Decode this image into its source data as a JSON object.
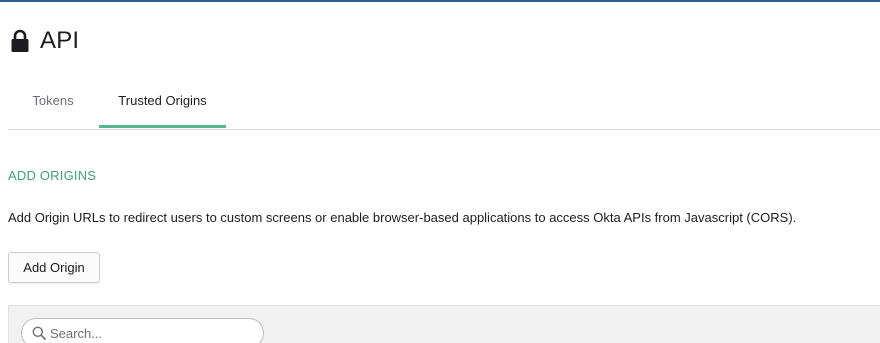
{
  "header": {
    "title": "API",
    "icon": "lock-icon"
  },
  "tabs": [
    {
      "label": "Tokens",
      "active": false
    },
    {
      "label": "Trusted Origins",
      "active": true
    }
  ],
  "section": {
    "heading": "ADD ORIGINS",
    "description": "Add Origin URLs to redirect users to custom screens or enable browser-based applications to access Okta APIs from Javascript (CORS).",
    "add_button_label": "Add Origin"
  },
  "search": {
    "placeholder": "Search...",
    "value": "",
    "icon": "search-icon"
  },
  "colors": {
    "accent": "#55b78f",
    "heading": "#3fa37b",
    "top_border": "#2b5f8f"
  }
}
